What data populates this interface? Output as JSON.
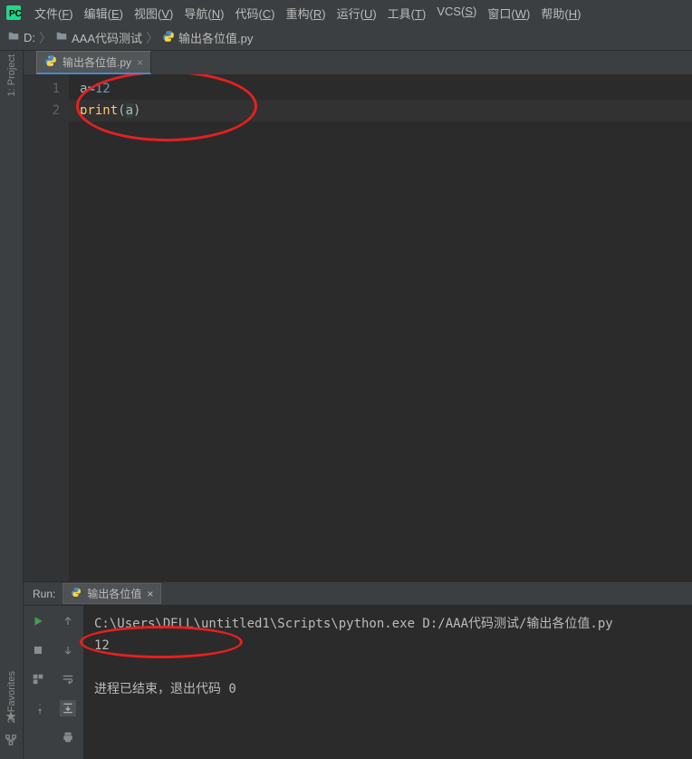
{
  "menu": {
    "items": [
      {
        "label": "文件",
        "mn": "F"
      },
      {
        "label": "编辑",
        "mn": "E"
      },
      {
        "label": "视图",
        "mn": "V"
      },
      {
        "label": "导航",
        "mn": "N"
      },
      {
        "label": "代码",
        "mn": "C"
      },
      {
        "label": "重构",
        "mn": "R"
      },
      {
        "label": "运行",
        "mn": "U"
      },
      {
        "label": "工具",
        "mn": "T"
      },
      {
        "label": "VCS",
        "mn": "S",
        "literal": true
      },
      {
        "label": "窗口",
        "mn": "W"
      },
      {
        "label": "帮助",
        "mn": "H"
      }
    ]
  },
  "breadcrumb": {
    "parts": [
      {
        "label": "D:",
        "type": "folder"
      },
      {
        "label": "AAA代码测试",
        "type": "folder"
      },
      {
        "label": "输出各位值.py",
        "type": "py"
      }
    ],
    "sep": "〉"
  },
  "sidebar": {
    "topLabel": "1: Project",
    "favLabel": "2: Favorites"
  },
  "editor": {
    "tab": {
      "label": "输出各位值.py"
    },
    "lines": [
      {
        "n": "1",
        "segments": [
          {
            "t": "a",
            "c": "var"
          },
          {
            "t": "=",
            "c": "op"
          },
          {
            "t": "12",
            "c": "num"
          }
        ]
      },
      {
        "n": "2",
        "hl": true,
        "segments": [
          {
            "t": "print",
            "c": "func"
          },
          {
            "t": "(",
            "c": "paren"
          },
          {
            "t": "a",
            "c": "arg"
          },
          {
            "t": ")",
            "c": "paren"
          }
        ]
      }
    ]
  },
  "run": {
    "header": "Run:",
    "tab": "输出各位值",
    "output": [
      "C:\\Users\\DELL\\untitled1\\Scripts\\python.exe D:/AAA代码测试/输出各位值.py",
      "12",
      "",
      "进程已结束，退出代码 0"
    ]
  }
}
